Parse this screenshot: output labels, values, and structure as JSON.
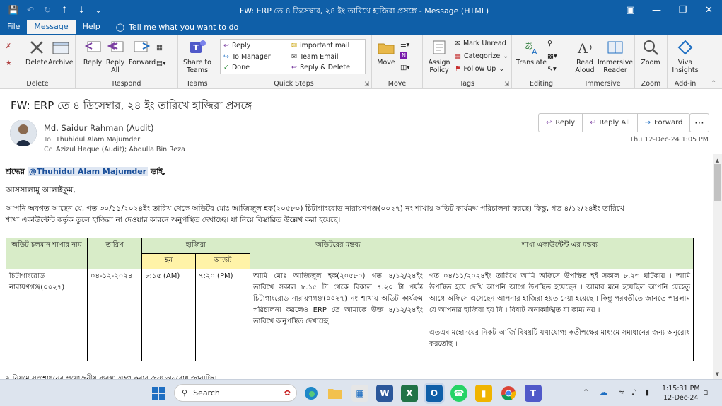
{
  "window": {
    "title": "FW: ERP তে ৪ ডিসেম্বার, ২৪ ইং তারিখে হাজিরা প্রসঙ্গে - Message (HTML)"
  },
  "ribbon_tabs": [
    "File",
    "Message",
    "Help"
  ],
  "tell_me": "Tell me what you want to do",
  "ribbon": {
    "delete": {
      "delete": "Delete",
      "archive": "Archive",
      "group": "Delete"
    },
    "respond": {
      "reply": "Reply",
      "reply_all": "Reply All",
      "forward": "Forward",
      "group": "Respond"
    },
    "teams": {
      "share": "Share to Teams",
      "group": "Teams"
    },
    "quick_steps": {
      "items": [
        "Reply",
        "To Manager",
        "Done",
        "important mail",
        "Team Email",
        "Reply & Delete"
      ],
      "group": "Quick Steps"
    },
    "move": {
      "move": "Move",
      "group": "Move"
    },
    "tags": {
      "assign": "Assign Policy",
      "mark_unread": "Mark Unread",
      "categorize": "Categorize",
      "follow_up": "Follow Up",
      "group": "Tags"
    },
    "editing": {
      "translate": "Translate",
      "group": "Editing"
    },
    "immersive": {
      "read_aloud": "Read Aloud",
      "immersive_reader": "Immersive Reader",
      "group": "Immersive"
    },
    "zoom": {
      "zoom": "Zoom",
      "group": "Zoom"
    },
    "addin": {
      "viva": "Viva Insights",
      "group": "Add-in"
    }
  },
  "message": {
    "subject": "FW: ERP তে ৪ ডিসেম্বার, ২৪ ইং তারিখে হাজিরা প্রসঙ্গে",
    "sender": "Md. Saidur Rahman (Audit)",
    "to_label": "To",
    "to": "Thuhidul Alam Majumder",
    "cc_label": "Cc",
    "cc": "Azizul Haque (Audit); Abdulla Bin Reza",
    "date": "Thu 12-Dec-24 1:05 PM",
    "actions": [
      "Reply",
      "Reply All",
      "Forward"
    ]
  },
  "body": {
    "greeting_prefix": "শ্রদ্ধেয়",
    "mention": "@Thuhidul Alam Majumder",
    "greeting_suffix": "ভাই,",
    "salam": "আসসালামু আলাইকুম,",
    "para1_line1": "আপনি অবগত আছেন যে, গত ৩০/১১/২০২৪ইং তারিখ থেকে অডিটর মোঃ আজিজুল হক(২০৫৮০) চিটাগাংরোড নারায়ণগঞ্জ(০০২৭) নং শাখায় অডিট কার্যক্রম পরিচালনা করছে। কিন্তু, গত ৪/১২/২৪ইং তারিখে",
    "para1_line2": "শাখা একাউন্টেন্ট কর্তৃক তুলে হাজিরা না দেওয়ার কারনে অনুপস্থিত দেখাচ্ছে। যা নিয়ে বিস্তারিত উল্লেখ করা হয়েছে।",
    "table": {
      "headers": {
        "branch": "অডিট চলমান শাখার নাম",
        "date": "তারিখ",
        "attendance": "হাজিরা",
        "in": "ইন",
        "out": "আউট",
        "auditor_comment": "অডিটরের মন্তব্য",
        "accountant_comment": "শাখা একাউন্টেন্ট এর মন্তব্য"
      },
      "row": {
        "branch": "চিটাগাংরোড নারায়ণগঞ্জ(০০২৭)",
        "date": "০৪-১২-২০২৪",
        "in": "৮:১৫ (AM)",
        "out": "৭:২০ (PM)",
        "auditor_comment": "আমি মোঃ আজিজুল হক(২০৫৮০) গত ৪/১২/২৪ইং তারিখে সকাল ৮.১৫ টা থেকে বিকাল ৭.২০ টা পর্যন্ত চিটাগাংরোড নারায়ণগঞ্জ(০০২৭) নং শাখায় অডিট কার্যক্রম পরিচালনা করলেও ERP তে আমাকে উক্ত ৪/১২/২৪ইং তারিখে অনুপস্থিত দেখাচ্ছে।",
        "accountant_comment_1": "গত ০৪/১১/২০২৪ইং তারিখে আমি অফিসে উপস্থিত হই সকাল ৮.২৩ ঘটিকায় । আমি উপস্থিত হয়ে দেখি আপনি আগে উপস্থিত হয়েছেন । আমার মনে হয়েছিল আপনি যেহেতু আগে অফিসে এসেছেন আপনার হাজিরা হয়ত দেয়া হয়েছে । কিন্তু পরবর্তীতে জানতে পারলাম যে আপনার হাজিরা হয় নি । বিষটি অনাকাঙ্খিত যা কাম্য নয় ।",
        "accountant_comment_2": "এতএব মহোদয়ের নিকট আর্জি বিষয়টি যথাযোগ্য কর্তীপক্ষের মাধ্যমে সমাধানের জন্য অনুরোধ করতেছি ।"
      }
    },
    "cutoff_line": "২ নিয়মে সংশোধনের প্রয়োজনীয় ব্যবস্থা গ্রহণ করার জন্য অনুরোধ জানাচ্ছি।"
  },
  "taskbar": {
    "search_placeholder": "Search",
    "time": "1:15:31 PM",
    "date": "12-Dec-24"
  }
}
